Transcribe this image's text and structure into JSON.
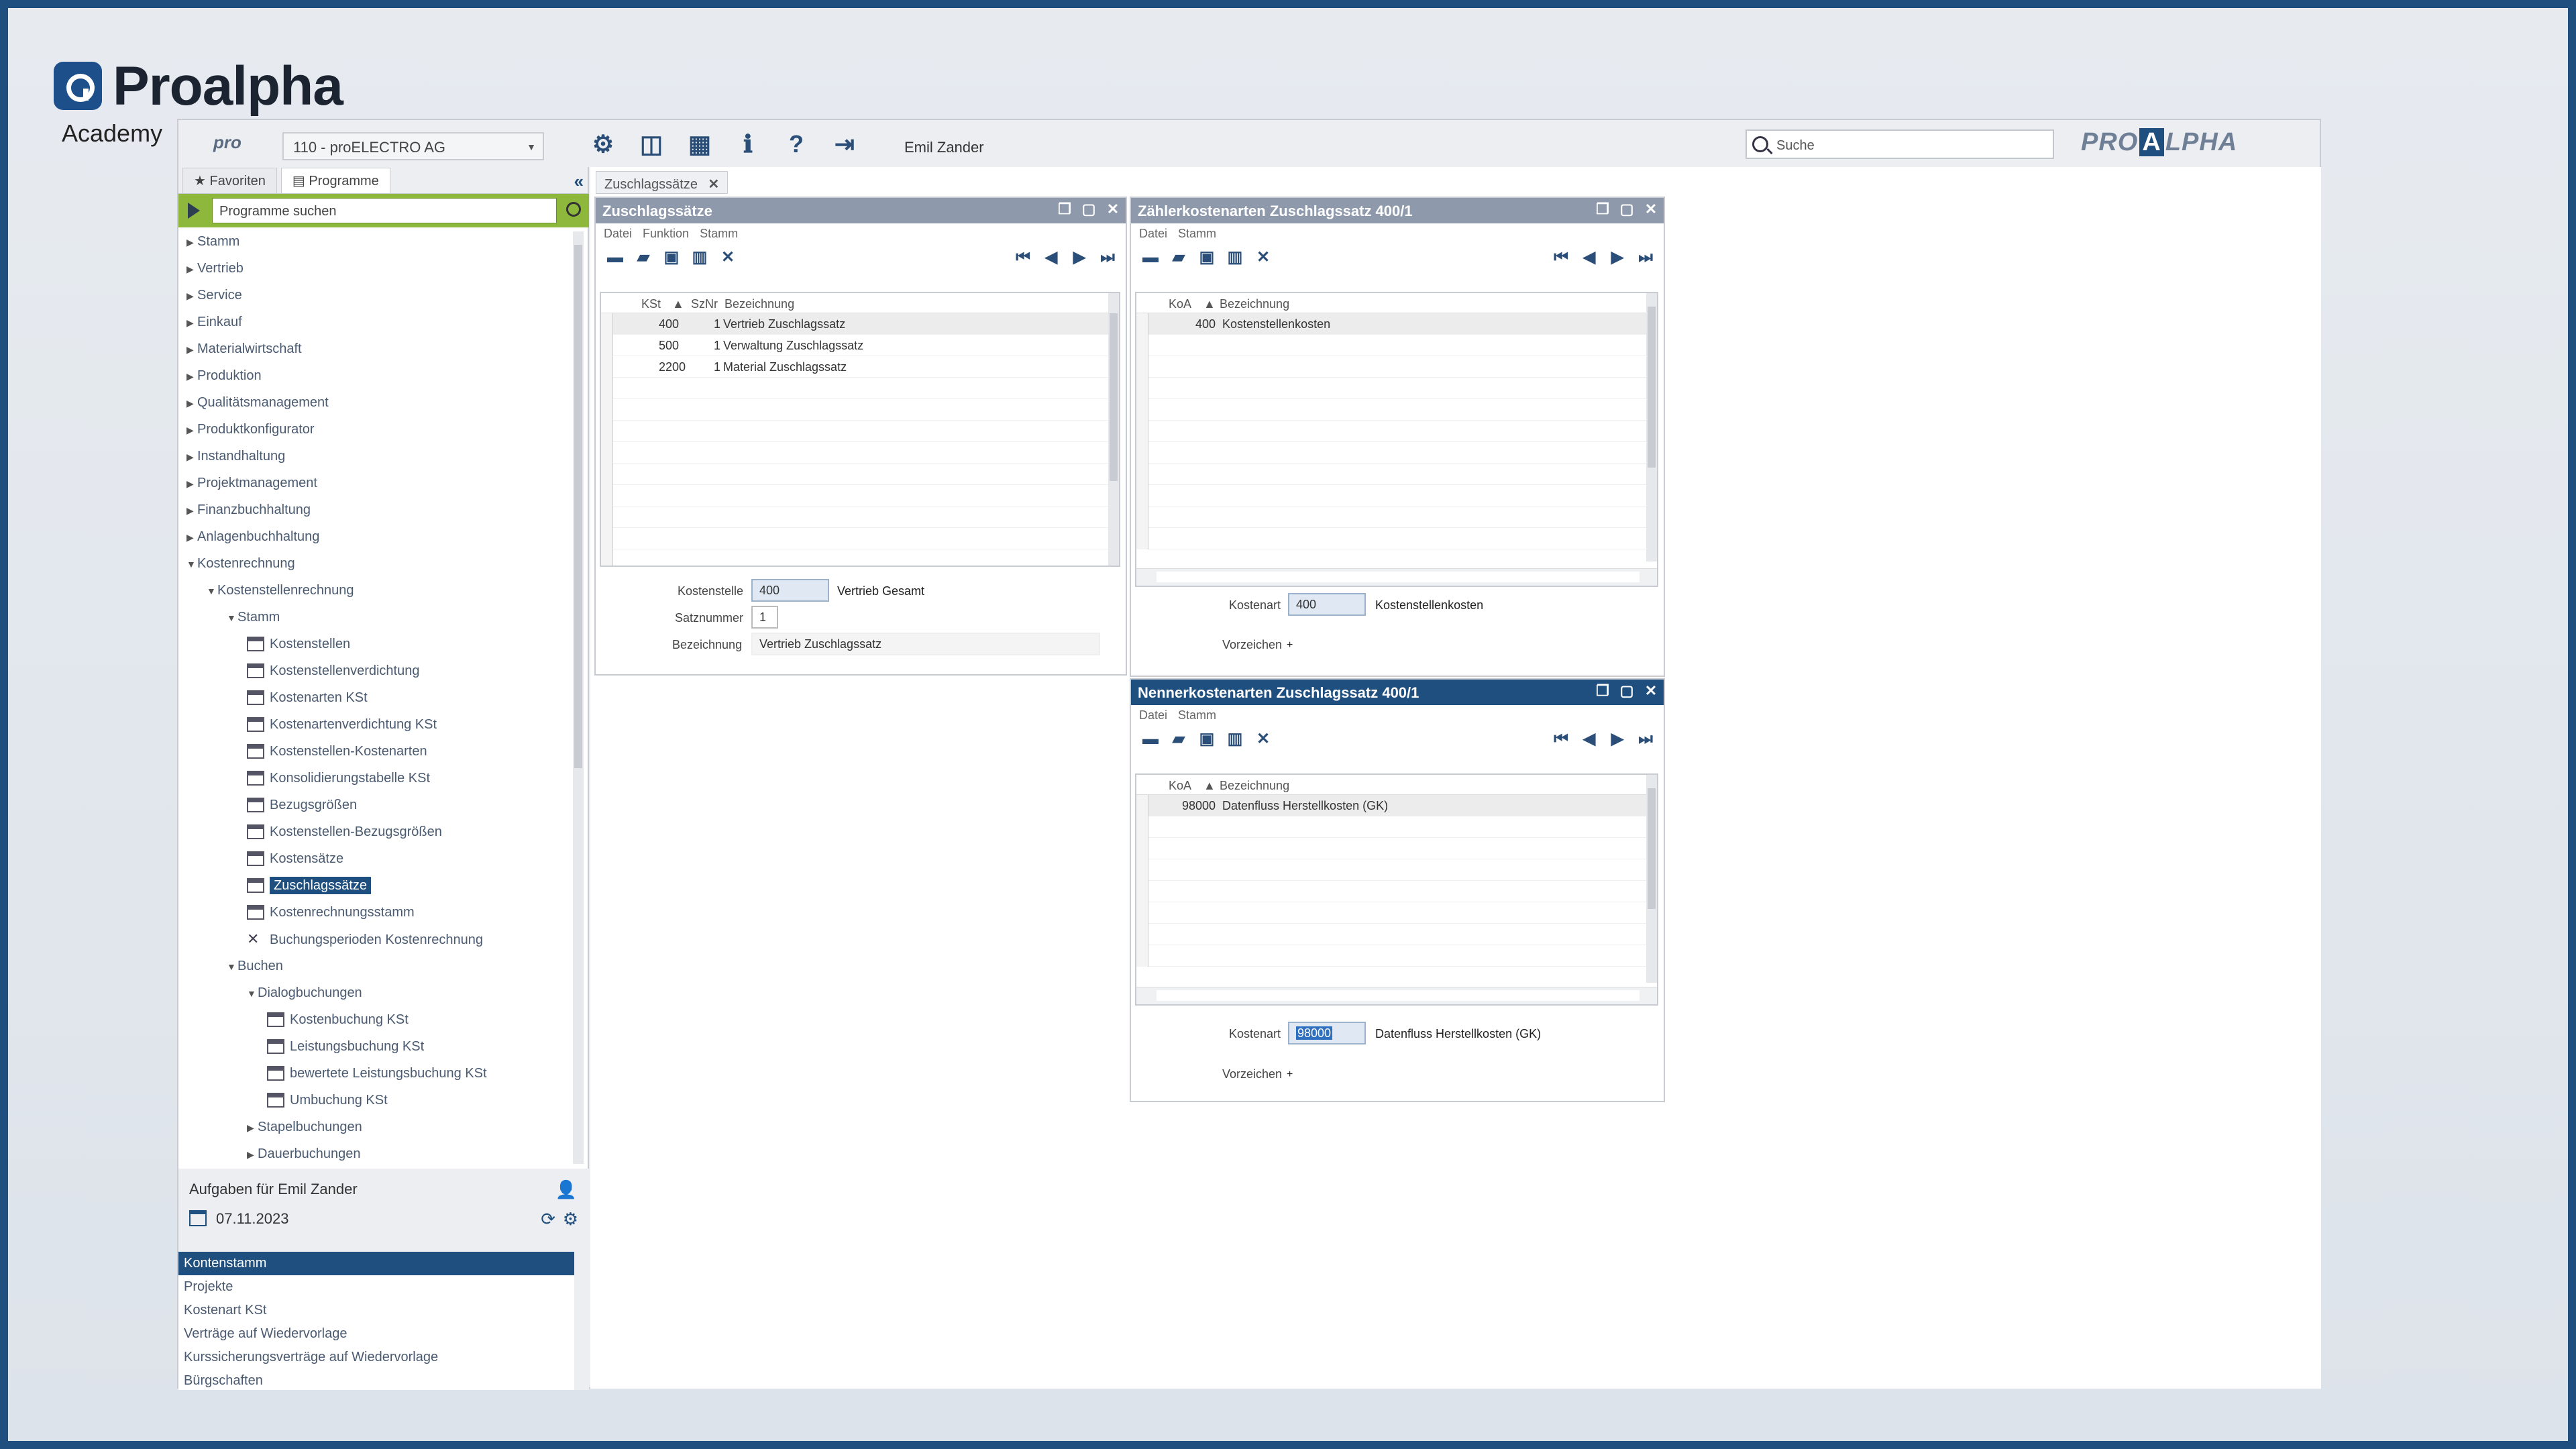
{
  "branding": {
    "logo_text": "Proalpha",
    "sub": "Academy"
  },
  "toolbar": {
    "company": "110 - proELECTRO AG",
    "user": "Emil Zander",
    "search_placeholder": "Suche",
    "brand_left": "PRO",
    "brand_mid": "A",
    "brand_right": "LPHA",
    "pro_badge": "pro"
  },
  "nav": {
    "tabs": [
      "Favoriten",
      "Programme"
    ],
    "search_placeholder": "Programme suchen",
    "tree": [
      {
        "label": "Stamm",
        "level": 0,
        "exp": "collapsed"
      },
      {
        "label": "Vertrieb",
        "level": 0,
        "exp": "collapsed"
      },
      {
        "label": "Service",
        "level": 0,
        "exp": "collapsed"
      },
      {
        "label": "Einkauf",
        "level": 0,
        "exp": "collapsed"
      },
      {
        "label": "Materialwirtschaft",
        "level": 0,
        "exp": "collapsed"
      },
      {
        "label": "Produktion",
        "level": 0,
        "exp": "collapsed"
      },
      {
        "label": "Qualitätsmanagement",
        "level": 0,
        "exp": "collapsed"
      },
      {
        "label": "Produktkonfigurator",
        "level": 0,
        "exp": "collapsed"
      },
      {
        "label": "Instandhaltung",
        "level": 0,
        "exp": "collapsed"
      },
      {
        "label": "Projektmanagement",
        "level": 0,
        "exp": "collapsed"
      },
      {
        "label": "Finanzbuchhaltung",
        "level": 0,
        "exp": "collapsed"
      },
      {
        "label": "Anlagenbuchhaltung",
        "level": 0,
        "exp": "collapsed"
      },
      {
        "label": "Kostenrechnung",
        "level": 0,
        "exp": "expanded"
      },
      {
        "label": "Kostenstellenrechnung",
        "level": 1,
        "exp": "expanded"
      },
      {
        "label": "Stamm",
        "level": 2,
        "exp": "expanded"
      },
      {
        "label": "Kostenstellen",
        "level": 3,
        "exp": "page"
      },
      {
        "label": "Kostenstellenverdichtung",
        "level": 3,
        "exp": "page"
      },
      {
        "label": "Kostenarten KSt",
        "level": 3,
        "exp": "page"
      },
      {
        "label": "Kostenartenverdichtung KSt",
        "level": 3,
        "exp": "page"
      },
      {
        "label": "Kostenstellen-Kostenarten",
        "level": 3,
        "exp": "page"
      },
      {
        "label": "Konsolidierungstabelle KSt",
        "level": 3,
        "exp": "page"
      },
      {
        "label": "Bezugsgrößen",
        "level": 3,
        "exp": "page"
      },
      {
        "label": "Kostenstellen-Bezugsgrößen",
        "level": 3,
        "exp": "page"
      },
      {
        "label": "Kostensätze",
        "level": 3,
        "exp": "page"
      },
      {
        "label": "Zuschlagssätze",
        "level": 3,
        "exp": "page",
        "selected": true
      },
      {
        "label": "Kostenrechnungsstamm",
        "level": 3,
        "exp": "page"
      },
      {
        "label": "Buchungsperioden Kostenrechnung",
        "level": 3,
        "exp": "tool"
      },
      {
        "label": "Buchen",
        "level": 2,
        "exp": "expanded"
      },
      {
        "label": "Dialogbuchungen",
        "level": 3,
        "exp": "expanded"
      },
      {
        "label": "Kostenbuchung KSt",
        "level": 4,
        "exp": "page"
      },
      {
        "label": "Leistungsbuchung KSt",
        "level": 4,
        "exp": "page"
      },
      {
        "label": "bewertete Leistungsbuchung KSt",
        "level": 4,
        "exp": "page"
      },
      {
        "label": "Umbuchung KSt",
        "level": 4,
        "exp": "page"
      },
      {
        "label": "Stapelbuchungen",
        "level": 3,
        "exp": "collapsed"
      },
      {
        "label": "Dauerbuchungen",
        "level": 3,
        "exp": "collapsed"
      }
    ]
  },
  "tasks": {
    "title": "Aufgaben für Emil Zander",
    "date": "07.11.2023",
    "items": [
      "Kontenstamm",
      "Projekte",
      "Kostenart KSt",
      "Verträge auf Wiedervorlage",
      "Kurssicherungsverträge auf Wiedervorlage",
      "Bürgschaften"
    ]
  },
  "content": {
    "tab": "Zuschlagssätze"
  },
  "win1": {
    "title": "Zuschlagssätze",
    "menu": [
      "Datei",
      "Funktion",
      "Stamm"
    ],
    "headers": {
      "kst": "KSt",
      "sznr": "SzNr",
      "bez": "Bezeichnung"
    },
    "rows": [
      {
        "kst": "400",
        "sznr": "1",
        "bez": "Vertrieb Zuschlagssatz"
      },
      {
        "kst": "500",
        "sznr": "1",
        "bez": "Verwaltung Zuschlagssatz"
      },
      {
        "kst": "2200",
        "sznr": "1",
        "bez": "Material Zuschlagssatz"
      }
    ],
    "fields": {
      "kst_label": "Kostenstelle",
      "kst_value": "400",
      "kst_desc": "Vertrieb Gesamt",
      "satz_label": "Satznummer",
      "satz_value": "1",
      "bez_label": "Bezeichnung",
      "bez_value": "Vertrieb Zuschlagssatz"
    }
  },
  "win2": {
    "title": "Zählerkostenarten Zuschlagssatz 400/1",
    "menu": [
      "Datei",
      "Stamm"
    ],
    "headers": {
      "koa": "KoA",
      "bez": "Bezeichnung"
    },
    "rows": [
      {
        "koa": "400",
        "bez": "Kostenstellenkosten"
      }
    ],
    "fields": {
      "koa_label": "Kostenart",
      "koa_value": "400",
      "koa_desc": "Kostenstellenkosten",
      "vz_label": "Vorzeichen",
      "vz_value": "+"
    }
  },
  "win3": {
    "title": "Nennerkostenarten Zuschlagssatz 400/1",
    "menu": [
      "Datei",
      "Stamm"
    ],
    "headers": {
      "koa": "KoA",
      "bez": "Bezeichnung"
    },
    "rows": [
      {
        "koa": "98000",
        "bez": "Datenfluss Herstellkosten (GK)"
      }
    ],
    "fields": {
      "koa_label": "Kostenart",
      "koa_value": "98000",
      "koa_desc": "Datenfluss Herstellkosten (GK)",
      "vz_label": "Vorzeichen",
      "vz_value": "+"
    }
  }
}
